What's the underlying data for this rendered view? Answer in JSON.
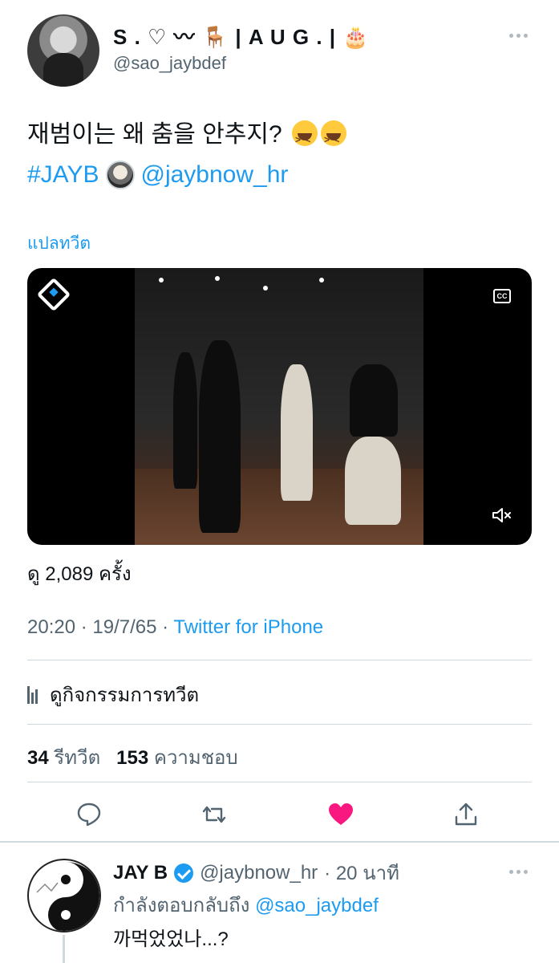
{
  "tweet": {
    "display_name": "S . ♡ 〰 🪑 | A U G . | 🎂",
    "handle": "@sao_jaybdef",
    "text": "재범이는 왜 춤을 안추지?",
    "hashtag": "#JAYB",
    "mention": "@jaybnow_hr",
    "translate_label": "แปลทวีต",
    "views": "ดู 2,089 ครั้ง",
    "time": "20:20",
    "date": "19/7/65",
    "source": "Twitter for iPhone",
    "activity_label": "ดูกิจกรรมการทวีต",
    "retweets_count": "34",
    "retweets_label": "รีทวีต",
    "likes_count": "153",
    "likes_label": "ความชอบ"
  },
  "actions": {
    "reply_icon": "reply-icon",
    "retweet_icon": "retweet-icon",
    "like_icon": "heart-icon",
    "share_icon": "share-icon",
    "liked_color": "#f91880"
  },
  "reply": {
    "name": "JAY B",
    "handle": "@jaybnow_hr",
    "time": "· 20 นาที",
    "replying_to_label": "กำลังตอบกลับถึง",
    "replying_to_mention": "@sao_jaybdef",
    "text": "까먹었었나...?"
  },
  "colors": {
    "link": "#1d9bf0",
    "secondary_text": "#536471"
  }
}
